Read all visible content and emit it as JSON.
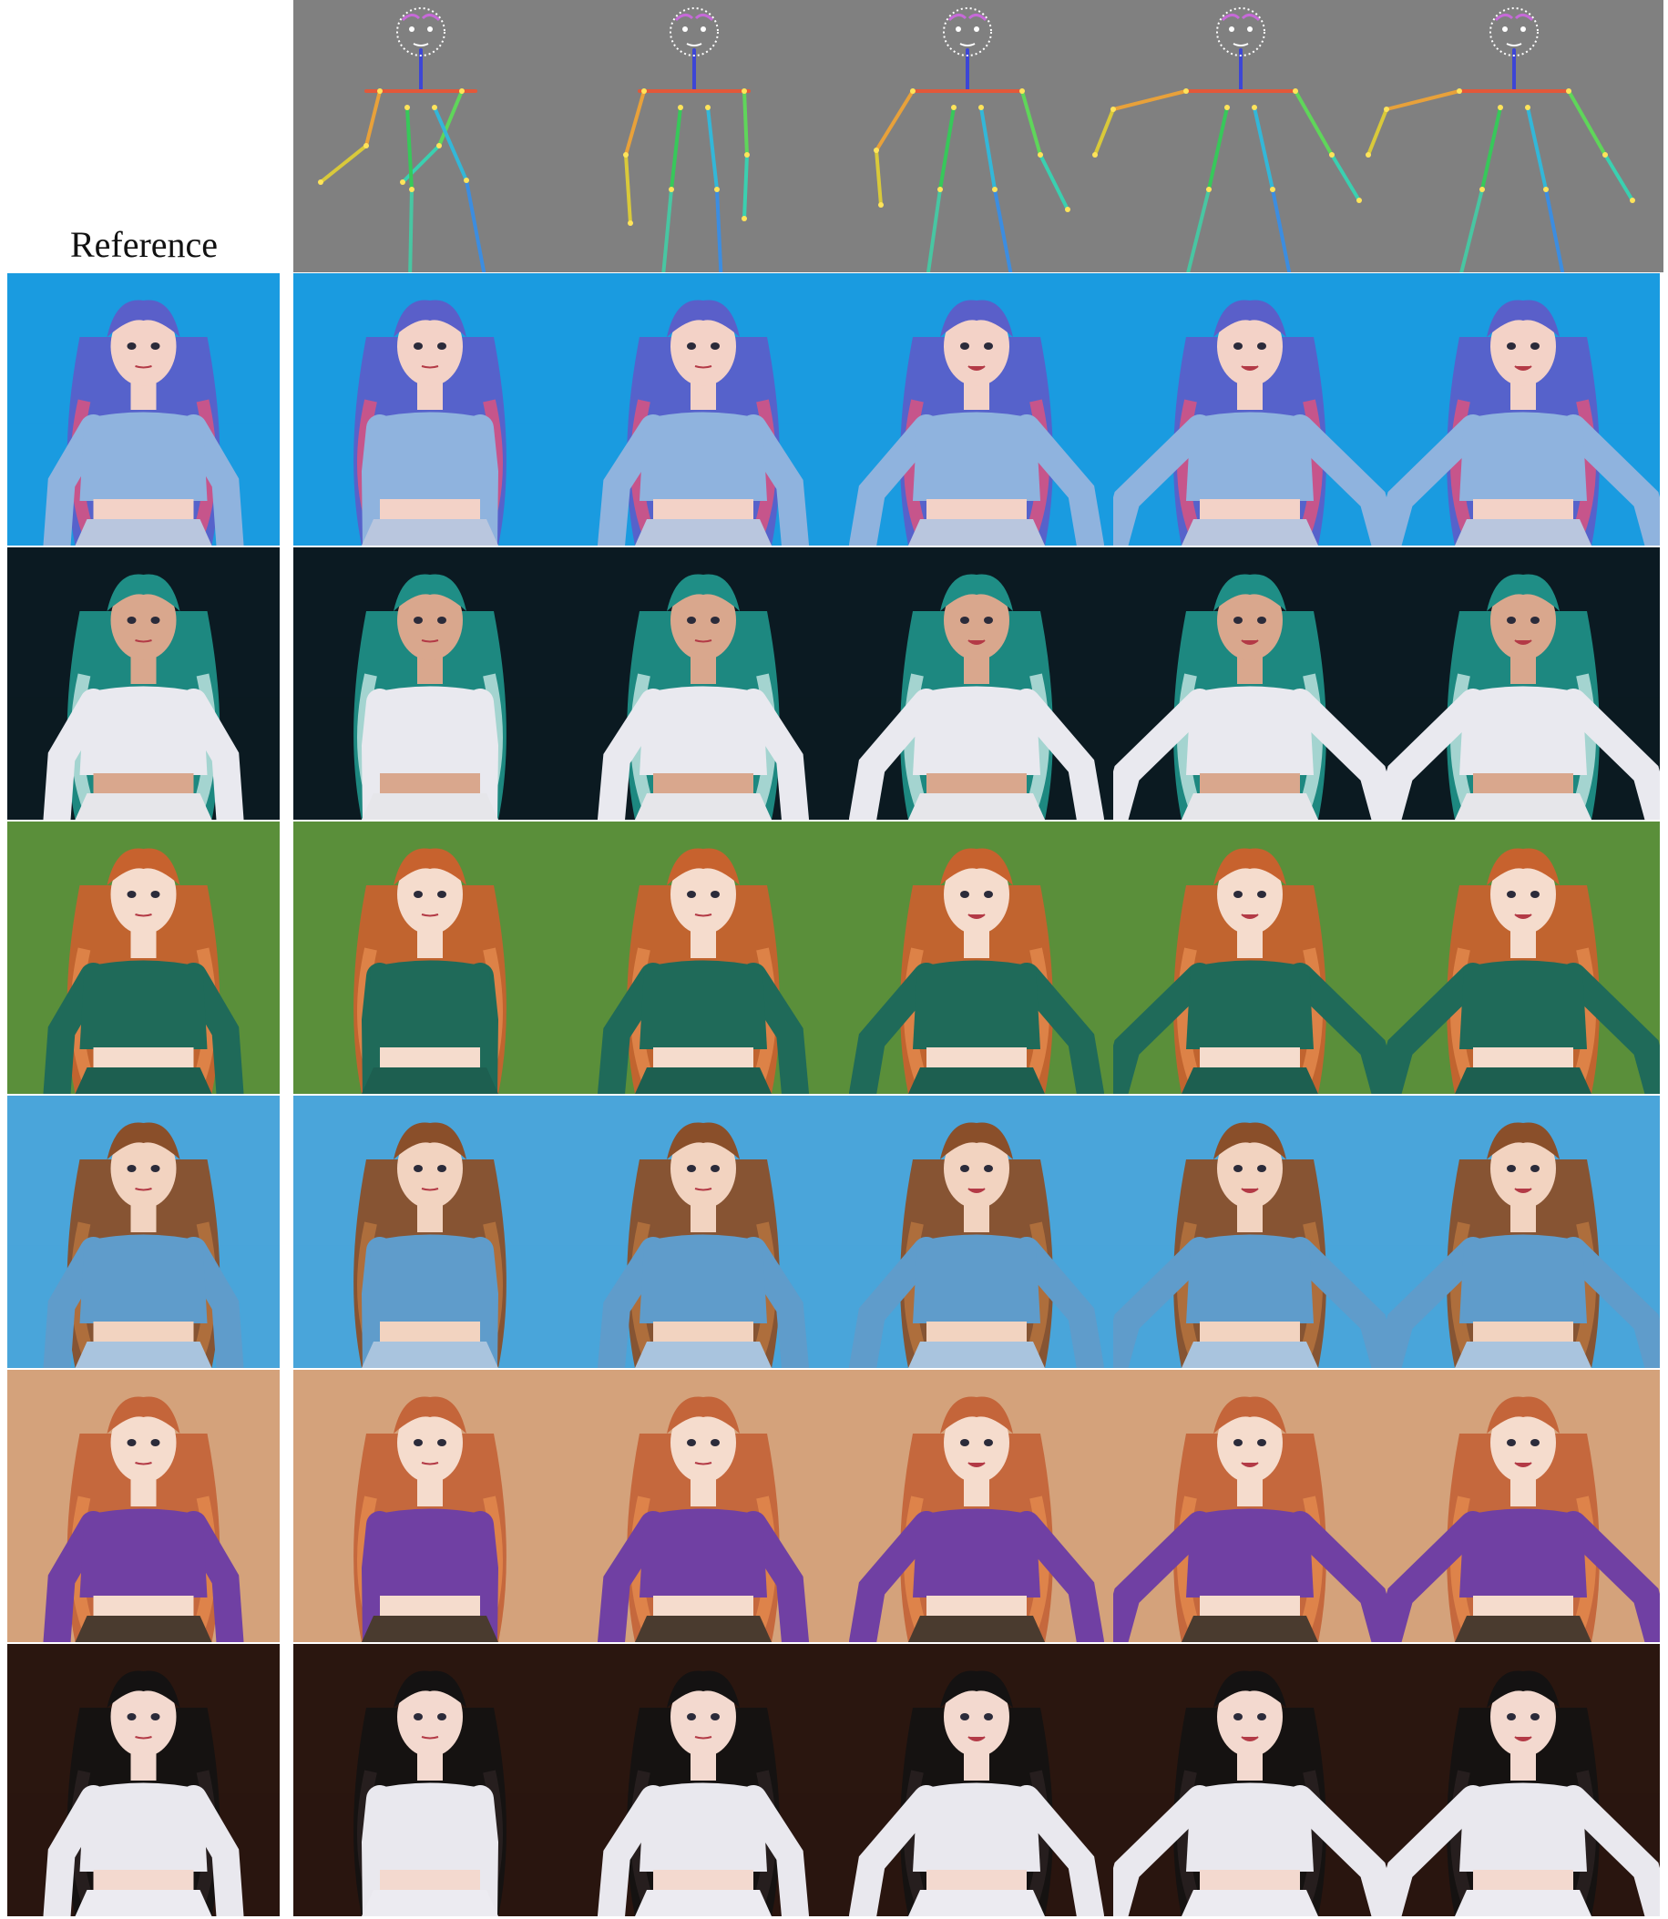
{
  "header": {
    "reference_label": "Reference"
  },
  "grid": {
    "frames_per_row": 5,
    "pose_frames": [
      {
        "name": "pose-frame-1",
        "pose": "arms-crossed-left"
      },
      {
        "name": "pose-frame-2",
        "pose": "arms-down"
      },
      {
        "name": "pose-frame-3",
        "pose": "arms-out-low"
      },
      {
        "name": "pose-frame-4",
        "pose": "arms-wide"
      },
      {
        "name": "pose-frame-5",
        "pose": "arms-wide"
      }
    ],
    "rows": [
      {
        "name": "row-blue-hair-sweater",
        "bg": "#1a9be0",
        "hair": "#5a5fc9",
        "hair2": "#e2527a",
        "skin": "#f3d2c7",
        "top": "#8fb3de",
        "bottom": "#b9c6de"
      },
      {
        "name": "row-teal-hair-white-top",
        "bg": "#0b1a22",
        "hair": "#1f8e86",
        "hair2": "#c7e7e4",
        "skin": "#d9a78d",
        "top": "#e9e9ef",
        "bottom": "#e6e6ea"
      },
      {
        "name": "row-orange-hair-green-dress",
        "bg": "#5a8f3a",
        "hair": "#c7622e",
        "hair2": "#e38a4d",
        "skin": "#f5dccd",
        "top": "#1f6a59",
        "bottom": "#1d5f50"
      },
      {
        "name": "row-brown-hair-blue-top",
        "bg": "#4aa5da",
        "hair": "#8a4f2a",
        "hair2": "#b8743f",
        "skin": "#f2d3c0",
        "top": "#5f9ccb",
        "bottom": "#a9c4de"
      },
      {
        "name": "row-orange-hair-purple-top",
        "bg": "#d4a27b",
        "hair": "#c4653a",
        "hair2": "#e38a4d",
        "skin": "#f5dccd",
        "top": "#7040a3",
        "bottom": "#4a3b2f"
      },
      {
        "name": "row-black-hair-white-top",
        "bg": "#2a160f",
        "hair": "#141212",
        "hair2": "#2a2222",
        "skin": "#f3d9cf",
        "top": "#e9e8ee",
        "bottom": "#ecebf1"
      }
    ]
  }
}
